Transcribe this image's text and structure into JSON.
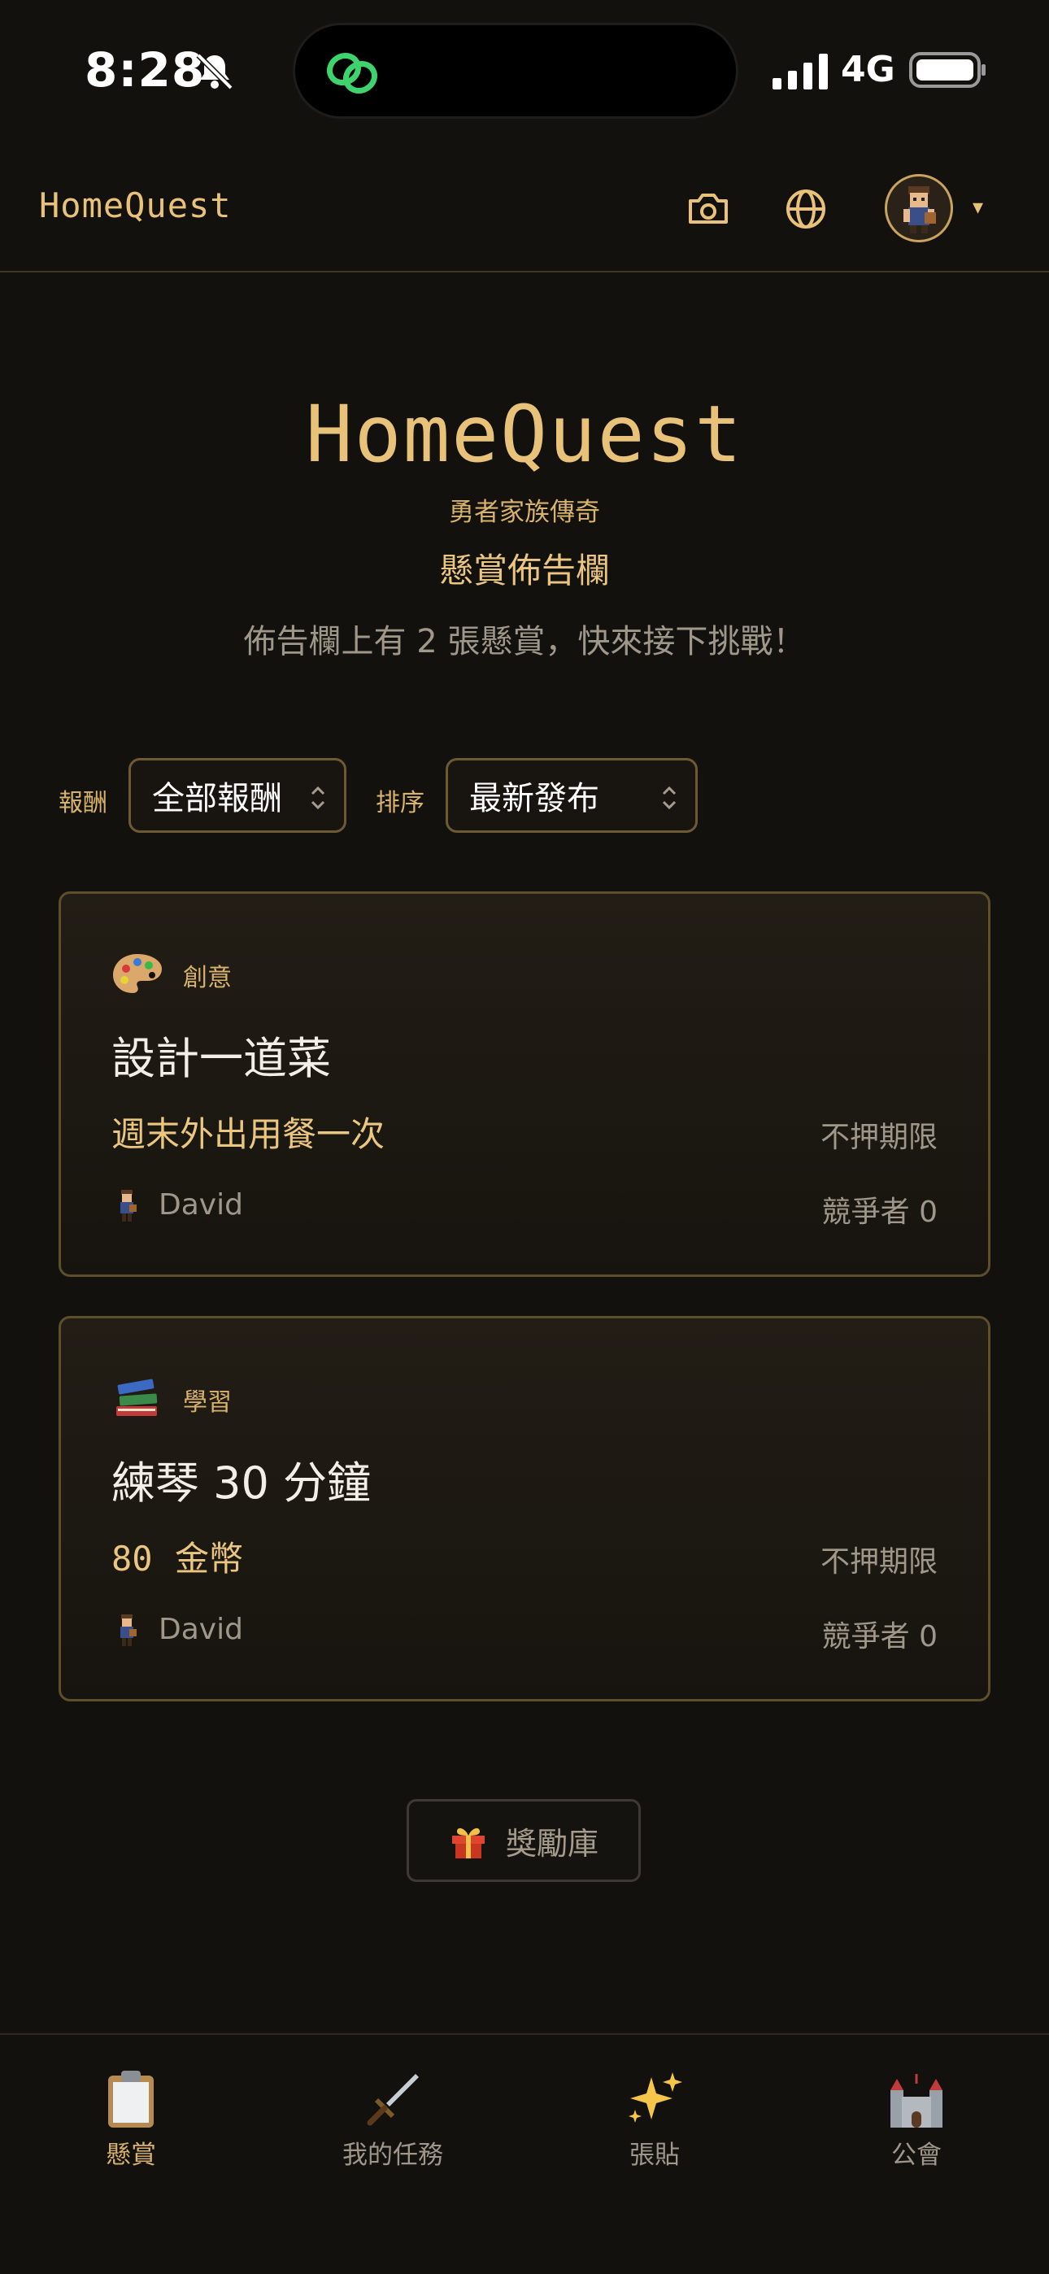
{
  "status_bar": {
    "time": "8:28",
    "network": "4G",
    "icons": [
      "bell-slash-icon",
      "link-icon",
      "signal-icon",
      "battery-icon"
    ]
  },
  "app_bar": {
    "brand": "HomeQuest",
    "icons": [
      "camera-icon",
      "globe-icon",
      "avatar",
      "caret-down-icon"
    ],
    "caret": "▾"
  },
  "hero": {
    "title": "HomeQuest",
    "tagline": "勇者家族傳奇",
    "board_title": "懸賞佈告欄",
    "description": "佈告欄上有 2 張懸賞，快來接下挑戰！"
  },
  "filters": {
    "reward_label": "報酬",
    "reward_value": "全部報酬",
    "sort_label": "排序",
    "sort_value": "最新發布"
  },
  "bounties": [
    {
      "category_icon": "palette-icon",
      "category": "創意",
      "title": "設計一道菜",
      "reward": "週末外出用餐一次",
      "deadline": "不押期限",
      "poster": "David",
      "competitors": "競爭者 0"
    },
    {
      "category_icon": "books-icon",
      "category": "學習",
      "title": "練琴 30 分鐘",
      "reward_amount": "80",
      "reward_unit": "金幣",
      "deadline": "不押期限",
      "poster": "David",
      "competitors": "競爭者 0"
    }
  ],
  "reward_store": {
    "icon": "gift-icon",
    "label": "獎勵庫"
  },
  "bottom_nav": [
    {
      "icon": "clipboard-icon",
      "label": "懸賞",
      "active": true
    },
    {
      "icon": "sword-icon",
      "label": "我的任務",
      "active": false
    },
    {
      "icon": "sparkles-icon",
      "label": "張貼",
      "active": false
    },
    {
      "icon": "castle-icon",
      "label": "公會",
      "active": false
    }
  ],
  "colors": {
    "background": "#13110e",
    "gold": "#e9c27a",
    "muted": "#9f978a",
    "card_border": "#5d4e2c"
  }
}
